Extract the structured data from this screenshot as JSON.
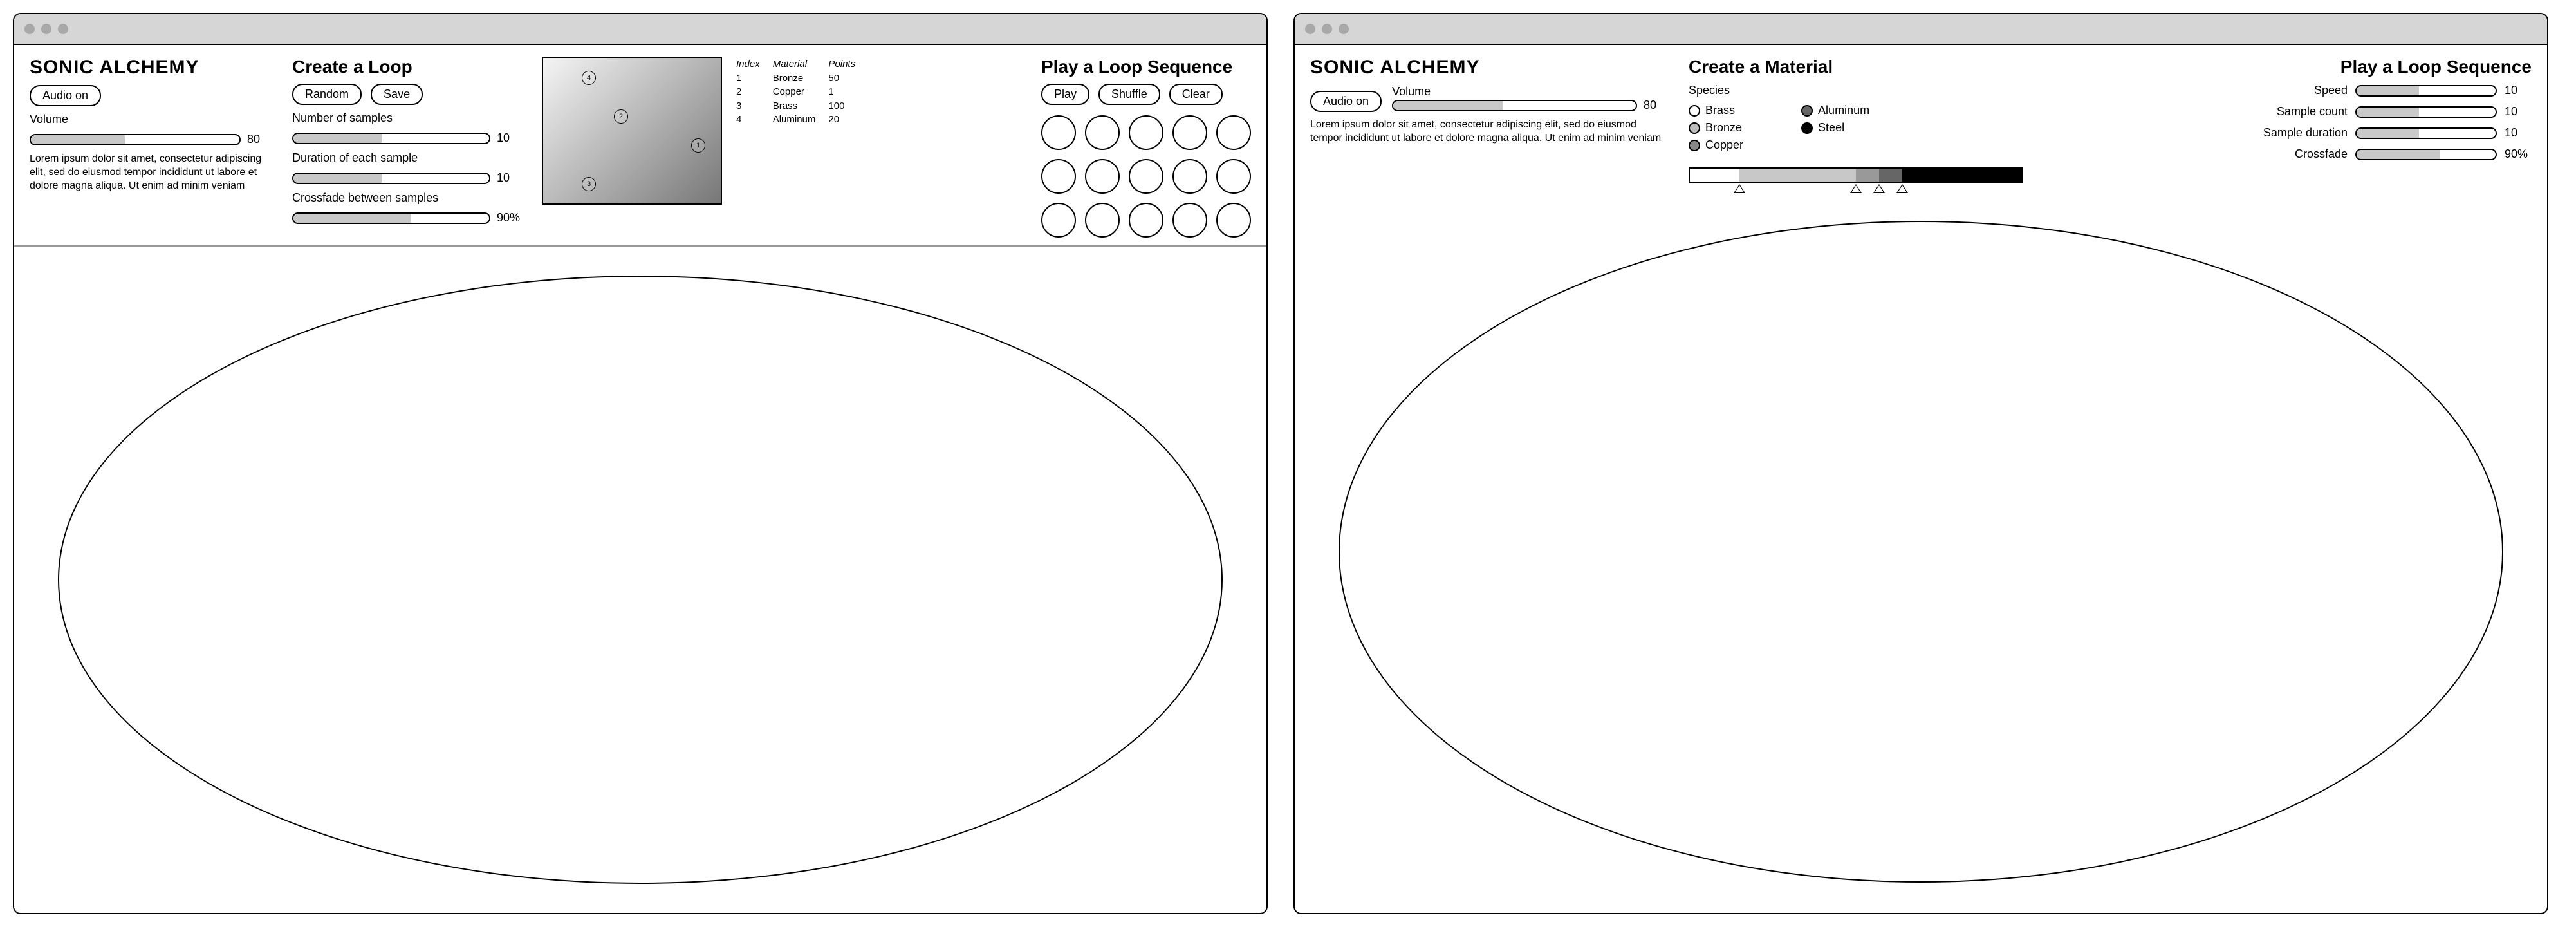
{
  "app_title": "SONIC ALCHEMY",
  "audio_btn": "Audio on",
  "volume_label": "Volume",
  "volume_value": "80",
  "lorem": "Lorem ipsum dolor sit amet, consectetur adipiscing elit, sed do eiusmod tempor incididunt ut labore et dolore magna aliqua. Ut enim ad minim veniam",
  "w1": {
    "create_title": "Create a Loop",
    "random_btn": "Random",
    "save_btn": "Save",
    "num_samples_label": "Number of samples",
    "num_samples_value": "10",
    "duration_label": "Duration of each sample",
    "duration_value": "10",
    "crossfade_label": "Crossfade between samples",
    "crossfade_value": "90%",
    "table": {
      "h_index": "Index",
      "h_material": "Material",
      "h_points": "Points",
      "rows": [
        {
          "i": "1",
          "m": "Bronze",
          "p": "50"
        },
        {
          "i": "2",
          "m": "Copper",
          "p": "1"
        },
        {
          "i": "3",
          "m": "Brass",
          "p": "100"
        },
        {
          "i": "4",
          "m": "Aluminum",
          "p": "20"
        }
      ]
    },
    "play_title": "Play a Loop Sequence",
    "play_btn": "Play",
    "shuffle_btn": "Shuffle",
    "clear_btn": "Clear"
  },
  "w2": {
    "create_title": "Create a Material",
    "species_label": "Species",
    "species": {
      "brass": "Brass",
      "bronze": "Bronze",
      "copper": "Copper",
      "aluminum": "Aluminum",
      "steel": "Steel"
    },
    "play_title": "Play a Loop Sequence",
    "speed_label": "Speed",
    "speed_value": "10",
    "sample_count_label": "Sample count",
    "sample_count_value": "10",
    "sample_duration_label": "Sample duration",
    "sample_duration_value": "10",
    "crossfade_label": "Crossfade",
    "crossfade_value": "90%"
  }
}
